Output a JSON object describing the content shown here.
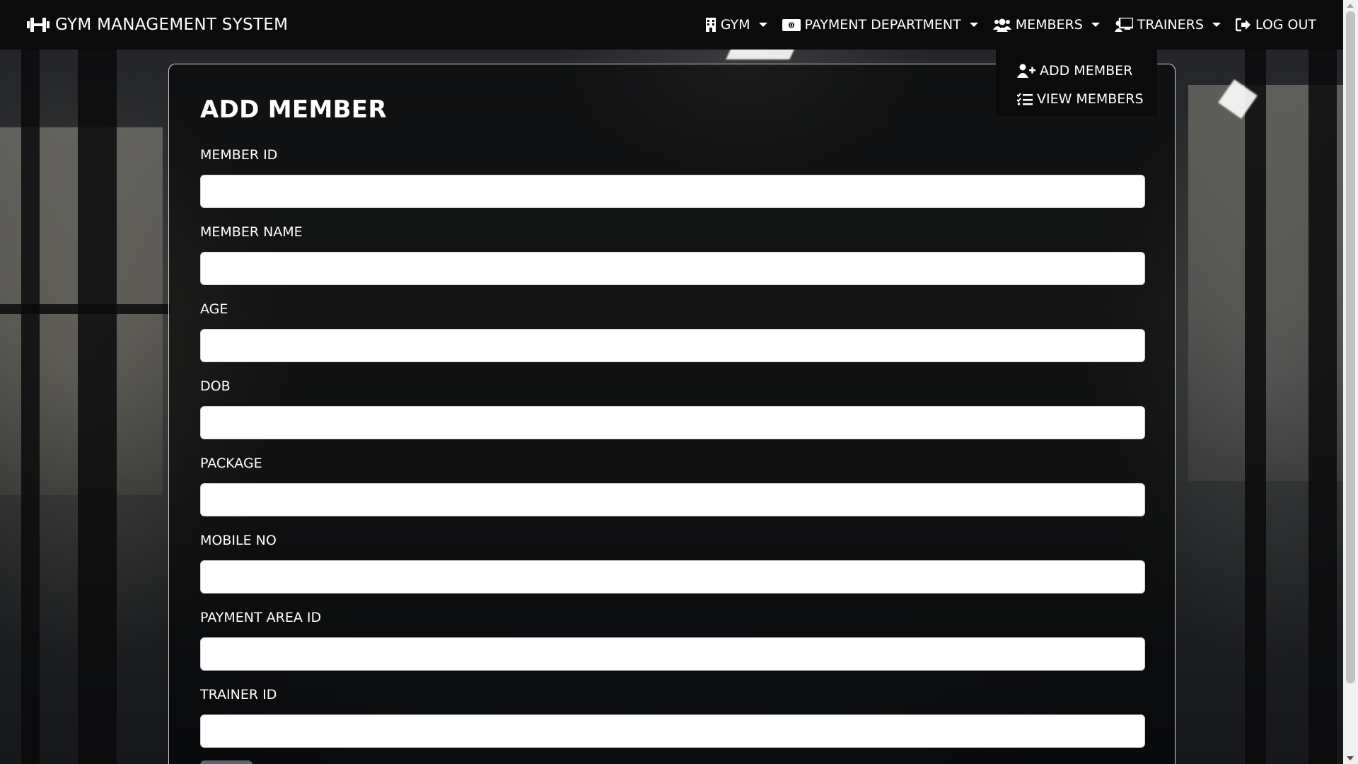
{
  "navbar": {
    "brand": "GYM MANAGEMENT SYSTEM",
    "items": [
      {
        "label": "GYM",
        "icon": "building-icon",
        "dropdown": true
      },
      {
        "label": "PAYMENT DEPARTMENT",
        "icon": "money-bill-icon",
        "dropdown": true
      },
      {
        "label": "MEMBERS",
        "icon": "users-icon",
        "dropdown": true
      },
      {
        "label": "TRAINERS",
        "icon": "chalkboard-user-icon",
        "dropdown": true
      },
      {
        "label": "LOG OUT",
        "icon": "sign-out-icon",
        "dropdown": false
      }
    ]
  },
  "members_dropdown": {
    "items": [
      {
        "label": "ADD MEMBER",
        "icon": "user-plus-icon"
      },
      {
        "label": "VIEW MEMBERS",
        "icon": "list-check-icon"
      }
    ]
  },
  "form": {
    "title": "ADD MEMBER",
    "fields": [
      {
        "label": "MEMBER ID",
        "value": ""
      },
      {
        "label": "MEMBER NAME",
        "value": ""
      },
      {
        "label": "AGE",
        "value": ""
      },
      {
        "label": "DOB",
        "value": ""
      },
      {
        "label": "PACKAGE",
        "value": ""
      },
      {
        "label": "MOBILE NO",
        "value": ""
      },
      {
        "label": "PAYMENT AREA ID",
        "value": ""
      },
      {
        "label": "TRAINER ID",
        "value": ""
      }
    ]
  },
  "colors": {
    "navbar_bg": "#0b0b0c",
    "card_border": "#ffffff",
    "input_bg": "#ffffff",
    "submit_button": "#6c757d"
  }
}
